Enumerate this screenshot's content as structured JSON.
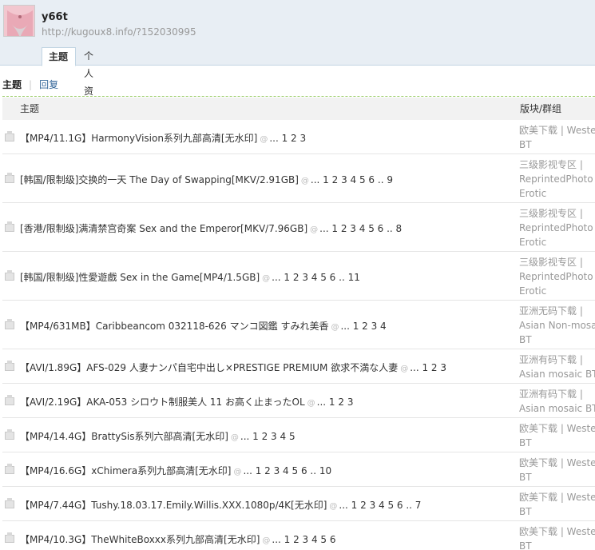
{
  "profile": {
    "username": "y66t",
    "url": "http://kugoux8.info/?152030995"
  },
  "tabs": [
    {
      "label": "主题"
    },
    {
      "label": "个人资料"
    }
  ],
  "subnav": {
    "current": "主题",
    "reply": "回复"
  },
  "table": {
    "col_topic": "主题",
    "col_forum": "版块/群组"
  },
  "rows": [
    {
      "title": "【MP4/11.1G】HarmonyVision系列九部高清[无水印]",
      "pages": "... 1 2 3",
      "forum1": "欧美下载 | Western",
      "forum2": "BT",
      "forum3": ""
    },
    {
      "title": "[韩国/限制级]交换的一天 The Day of Swapping[MKV/2.91GB]",
      "pages": "... 1 2 3 4 5 6 .. 9",
      "forum1": "三级影视专区 |",
      "forum2": "ReprintedPhoto and",
      "forum3": "Erotic"
    },
    {
      "title": "[香港/限制级]满清禁宫奇案 Sex and the Emperor[MKV/7.96GB]",
      "pages": "... 1 2 3 4 5 6 .. 8",
      "forum1": "三级影视专区 |",
      "forum2": "ReprintedPhoto and",
      "forum3": "Erotic"
    },
    {
      "title": "[韩国/限制级]性愛遊戲 Sex in the Game[MP4/1.5GB]",
      "pages": "... 1 2 3 4 5 6 .. 11",
      "forum1": "三级影视专区 |",
      "forum2": "ReprintedPhoto and",
      "forum3": "Erotic"
    },
    {
      "title": "【MP4/631MB】Caribbeancom 032118-626 マンコ図鑑 すみれ美香",
      "pages": "... 1 2 3 4",
      "forum1": "亚洲无码下载 |",
      "forum2": "Asian Non-mosaic",
      "forum3": "BT"
    },
    {
      "title": "【AVI/1.89G】AFS-029 人妻ナンパ自宅中出し×PRESTIGE PREMIUM 欲求不満な人妻",
      "pages": "... 1 2 3",
      "forum1": "亚洲有码下载 |",
      "forum2": "Asian mosaic BT",
      "forum3": ""
    },
    {
      "title": "【AVI/2.19G】AKA-053 シロウト制服美人 11 お高く止まったOL",
      "pages": "... 1 2 3",
      "forum1": "亚洲有码下载 |",
      "forum2": "Asian mosaic BT",
      "forum3": ""
    },
    {
      "title": "【MP4/14.4G】BrattySis系列六部高清[无水印]",
      "pages": "... 1 2 3 4 5",
      "forum1": "欧美下载 | Western",
      "forum2": "BT",
      "forum3": ""
    },
    {
      "title": "【MP4/16.6G】xChimera系列九部高清[无水印]",
      "pages": "... 1 2 3 4 5 6 .. 10",
      "forum1": "欧美下载 | Western",
      "forum2": "BT",
      "forum3": ""
    },
    {
      "title": "【MP4/7.44G】Tushy.18.03.17.Emily.Willis.XXX.1080p/4K[无水印]",
      "pages": "... 1 2 3 4 5 6 .. 7",
      "forum1": "欧美下载 | Western",
      "forum2": "BT",
      "forum3": ""
    },
    {
      "title": "【MP4/10.3G】TheWhiteBoxxx系列九部高清[无水印]",
      "pages": "... 1 2 3 4 5 6",
      "forum1": "欧美下载 | Western",
      "forum2": "BT",
      "forum3": ""
    }
  ]
}
